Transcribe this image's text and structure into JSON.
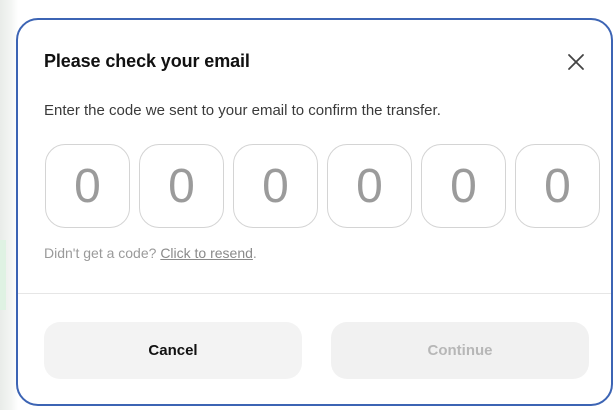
{
  "modal": {
    "title": "Please check your email",
    "description": "Enter the code we sent to your email to confirm the transfer.",
    "code_digits": [
      "0",
      "0",
      "0",
      "0",
      "0",
      "0"
    ],
    "resend_prefix": "Didn't get a code? ",
    "resend_link": "Click to resend",
    "resend_suffix": ".",
    "cancel_label": "Cancel",
    "continue_label": "Continue",
    "close_icon": "close-icon"
  },
  "colors": {
    "border_accent": "#3c64b4",
    "digit_color": "#9b9b9b",
    "disabled_text": "#b7b7b7"
  }
}
